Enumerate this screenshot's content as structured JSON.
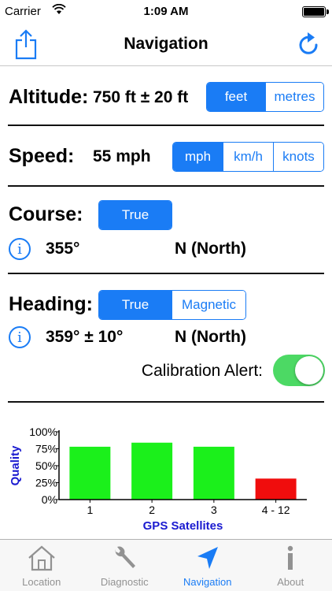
{
  "status": {
    "carrier": "Carrier",
    "time": "1:09 AM"
  },
  "nav": {
    "title": "Navigation"
  },
  "altitude": {
    "label": "Altitude:",
    "value": "750 ft ± 20 ft",
    "options": [
      "feet",
      "metres"
    ],
    "selected": 0
  },
  "speed": {
    "label": "Speed:",
    "value": "55 mph",
    "options": [
      "mph",
      "km/h",
      "knots"
    ],
    "selected": 0
  },
  "course": {
    "label": "Course:",
    "options": [
      "True"
    ],
    "selected": 0,
    "degrees": "355°",
    "direction": "N (North)",
    "info_glyph": "i"
  },
  "heading": {
    "label": "Heading:",
    "options": [
      "True",
      "Magnetic"
    ],
    "selected": 0,
    "degrees": "359° ± 10°",
    "direction": "N (North)",
    "info_glyph": "i",
    "calibration_label": "Calibration Alert:",
    "calibration_on": true
  },
  "chart_data": {
    "type": "bar",
    "categories": [
      "1",
      "2",
      "3",
      "4 - 12"
    ],
    "values": [
      78,
      84,
      78,
      31
    ],
    "colors": [
      "#1bf01b",
      "#1bf01b",
      "#1bf01b",
      "#f00d0d"
    ],
    "ylabel": "Quality",
    "xlabel": "GPS Satellites",
    "ylim": [
      0,
      100
    ],
    "yticks": [
      "0%",
      "25%",
      "50%",
      "75%",
      "100%"
    ],
    "label_color": "#1a1ad0"
  },
  "tabs": [
    {
      "label": "Location",
      "icon": "house-icon"
    },
    {
      "label": "Diagnostic",
      "icon": "wrench-icon"
    },
    {
      "label": "Navigation",
      "icon": "navigation-arrow-icon"
    },
    {
      "label": "About",
      "icon": "info-icon"
    }
  ],
  "colors": {
    "accent": "#1a7cf5",
    "toggle_on": "#4cd964",
    "tab_inactive": "#929292"
  }
}
